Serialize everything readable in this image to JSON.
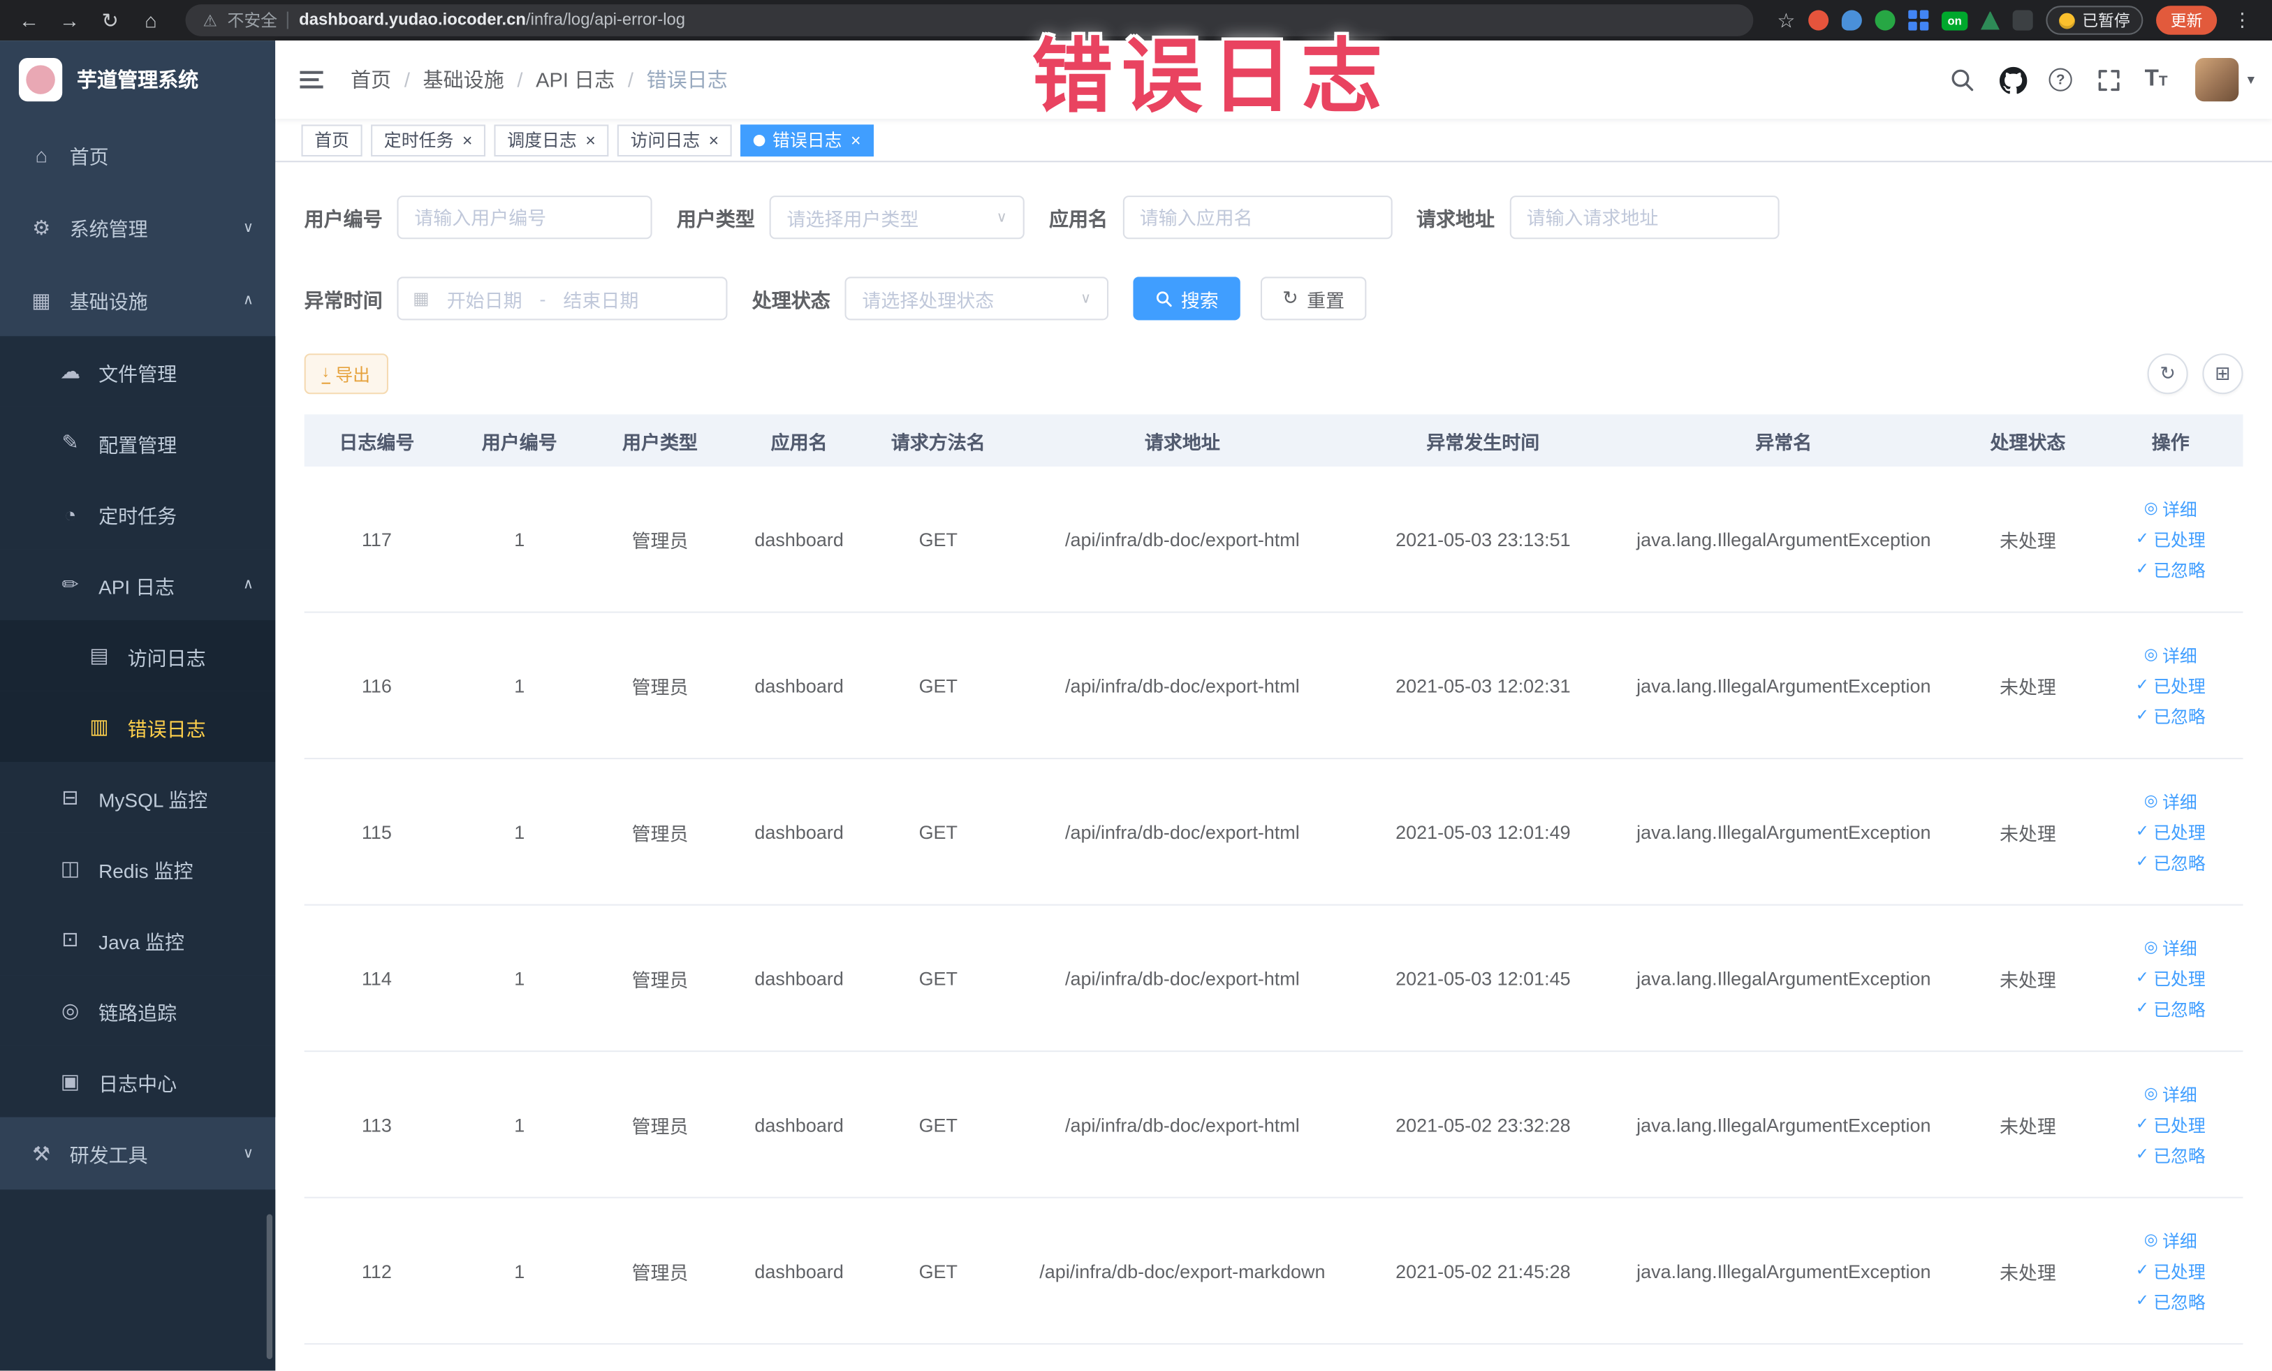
{
  "colors": {
    "accent": "#409eff",
    "sidebar_bg": "#304156",
    "sidebar_active": "#ffd04b",
    "annotation_red": "#e94360",
    "update_button": "#e25a3c",
    "export_warning": "#e6a23c",
    "active_tab": "#409eff"
  },
  "glyphs": {
    "back": "←",
    "forward": "→",
    "reload": "↻",
    "home": "⌂",
    "warning": "⚠",
    "star": "☆",
    "kebab": "⋮",
    "chevron_down": "∨",
    "chevron_up": "∧",
    "caret_down": "▾",
    "close": "×",
    "menu_home": "⌂",
    "menu_system": "⚙",
    "menu_infra": "▦",
    "menu_file": "☁",
    "menu_config": "✎",
    "menu_job": "◔",
    "menu_apilog": "✏",
    "menu_accesslog": "▤",
    "menu_errorlog": "▥",
    "menu_mysql": "⊟",
    "menu_redis": "◫",
    "menu_java": "⊡",
    "menu_trace": "◎",
    "menu_logcenter": "▣",
    "menu_tools": "⚒",
    "calendar": "▦",
    "download": "↓",
    "refresh": "↻",
    "columns": "⊞",
    "eye": "◎",
    "check": "✓",
    "question": "?",
    "font_size": "T"
  },
  "browser": {
    "security_label": "不安全",
    "url_host": "dashboard.yudao.iocoder.cn",
    "url_path": "/infra/log/api-error-log",
    "extension_badge": "on",
    "paused_button": "已暂停",
    "update_button": "更新"
  },
  "annotation": {
    "text": "错误日志"
  },
  "sidebar": {
    "logo_title": "芋道管理系统",
    "items": [
      {
        "label": "首页"
      },
      {
        "label": "系统管理"
      },
      {
        "label": "基础设施"
      },
      {
        "label": "文件管理"
      },
      {
        "label": "配置管理"
      },
      {
        "label": "定时任务"
      },
      {
        "label": "API 日志"
      },
      {
        "label": "访问日志"
      },
      {
        "label": "错误日志"
      },
      {
        "label": "MySQL 监控"
      },
      {
        "label": "Redis 监控"
      },
      {
        "label": "Java 监控"
      },
      {
        "label": "链路追踪"
      },
      {
        "label": "日志中心"
      },
      {
        "label": "研发工具"
      }
    ]
  },
  "breadcrumb": {
    "items": [
      "首页",
      "基础设施",
      "API 日志",
      "错误日志"
    ],
    "separator": "/"
  },
  "tabs": [
    {
      "label": "首页"
    },
    {
      "label": "定时任务"
    },
    {
      "label": "调度日志"
    },
    {
      "label": "访问日志"
    },
    {
      "label": "错误日志"
    }
  ],
  "filters": {
    "user_id": {
      "label": "用户编号",
      "placeholder": "请输入用户编号"
    },
    "user_type": {
      "label": "用户类型",
      "placeholder": "请选择用户类型"
    },
    "app_name": {
      "label": "应用名",
      "placeholder": "请输入应用名"
    },
    "request_url": {
      "label": "请求地址",
      "placeholder": "请输入请求地址"
    },
    "exception_time": {
      "label": "异常时间",
      "start_placeholder": "开始日期",
      "separator": "-",
      "end_placeholder": "结束日期"
    },
    "process_status": {
      "label": "处理状态",
      "placeholder": "请选择处理状态"
    },
    "search_button": "搜索",
    "reset_button": "重置"
  },
  "toolbar": {
    "export_button": "导出"
  },
  "table": {
    "columns": [
      "日志编号",
      "用户编号",
      "用户类型",
      "应用名",
      "请求方法名",
      "请求地址",
      "异常发生时间",
      "异常名",
      "处理状态",
      "操作"
    ],
    "actions": [
      "详细",
      "已处理",
      "已忽略"
    ],
    "rows": [
      {
        "id": "117",
        "user_id": "1",
        "user_type": "管理员",
        "app": "dashboard",
        "method": "GET",
        "url": "/api/infra/db-doc/export-html",
        "time": "2021-05-03 23:13:51",
        "exception": "java.lang.IllegalArgumentException",
        "status": "未处理"
      },
      {
        "id": "116",
        "user_id": "1",
        "user_type": "管理员",
        "app": "dashboard",
        "method": "GET",
        "url": "/api/infra/db-doc/export-html",
        "time": "2021-05-03 12:02:31",
        "exception": "java.lang.IllegalArgumentException",
        "status": "未处理"
      },
      {
        "id": "115",
        "user_id": "1",
        "user_type": "管理员",
        "app": "dashboard",
        "method": "GET",
        "url": "/api/infra/db-doc/export-html",
        "time": "2021-05-03 12:01:49",
        "exception": "java.lang.IllegalArgumentException",
        "status": "未处理"
      },
      {
        "id": "114",
        "user_id": "1",
        "user_type": "管理员",
        "app": "dashboard",
        "method": "GET",
        "url": "/api/infra/db-doc/export-html",
        "time": "2021-05-03 12:01:45",
        "exception": "java.lang.IllegalArgumentException",
        "status": "未处理"
      },
      {
        "id": "113",
        "user_id": "1",
        "user_type": "管理员",
        "app": "dashboard",
        "method": "GET",
        "url": "/api/infra/db-doc/export-html",
        "time": "2021-05-02 23:32:28",
        "exception": "java.lang.IllegalArgumentException",
        "status": "未处理"
      },
      {
        "id": "112",
        "user_id": "1",
        "user_type": "管理员",
        "app": "dashboard",
        "method": "GET",
        "url": "/api/infra/db-doc/export-markdown",
        "time": "2021-05-02 21:45:28",
        "exception": "java.lang.IllegalArgumentException",
        "status": "未处理"
      }
    ]
  }
}
